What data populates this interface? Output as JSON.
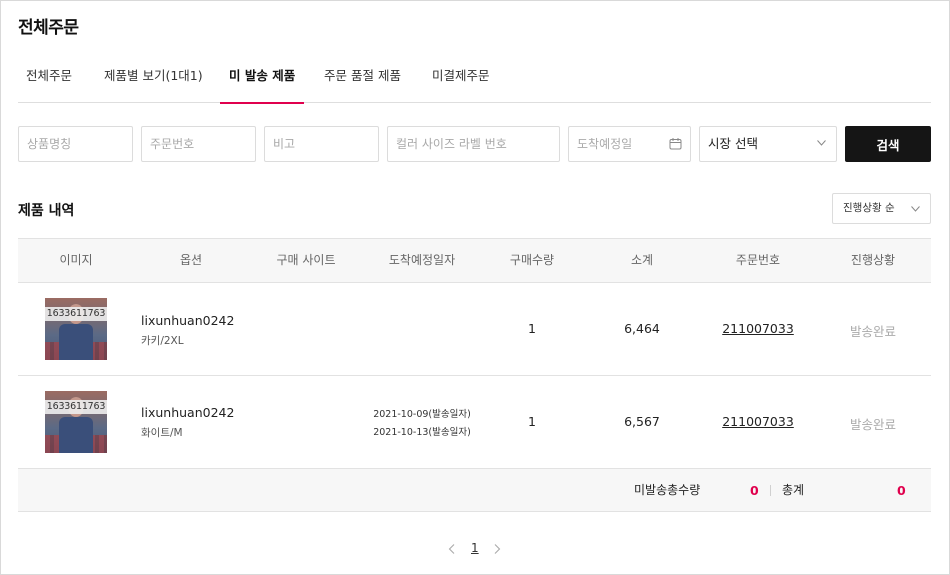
{
  "page": {
    "title": "전체주문"
  },
  "tabs": [
    {
      "label": "전체주문"
    },
    {
      "label": "제품별 보기(1대1)"
    },
    {
      "label": "미 발송 제품"
    },
    {
      "label": "주문 품절 제품"
    },
    {
      "label": "미결제주문"
    }
  ],
  "active_tab": "미 발송 제품",
  "filters": {
    "product_name_placeholder": "상품명칭",
    "order_no_placeholder": "주문번호",
    "note_placeholder": "비고",
    "label_no_placeholder": "컬러 사이즈 라벨 번호",
    "arrival_date_placeholder": "도착예정일",
    "market_select": "시장 선택",
    "search_button": "검색"
  },
  "section": {
    "title": "제품 내역",
    "sort_select": "진행상황 순"
  },
  "table": {
    "headers": [
      "이미지",
      "옵션",
      "구매 사이트",
      "도착예정일자",
      "구매수량",
      "소계",
      "주문번호",
      "진행상황"
    ],
    "rows": [
      {
        "image_id": "1633611763",
        "option_name": "lixunhuan0242",
        "option_detail": "카키/2XL",
        "site": "",
        "dates": [
          "",
          ""
        ],
        "qty": "1",
        "subtotal": "6,464",
        "order_no": "211007033",
        "status": "발송완료"
      },
      {
        "image_id": "1633611763",
        "option_name": "lixunhuan0242",
        "option_detail": "화이트/M",
        "site": "",
        "dates": [
          "2021-10-09(발송일자)",
          "2021-10-13(발송일자)"
        ],
        "qty": "1",
        "subtotal": "6,567",
        "order_no": "211007033",
        "status": "발송완료"
      }
    ]
  },
  "summary": {
    "unsent_label": "미발송총수량",
    "unsent_value": "0",
    "total_label": "총계",
    "total_value": "0"
  },
  "pagination": {
    "current": "1"
  },
  "colors": {
    "accent": "#e0004d",
    "button_dark": "#151515",
    "header_bg": "#f7f7f7"
  },
  "icons": [
    "calendar-icon",
    "chevron-down-icon",
    "chevron-left-icon",
    "chevron-right-icon"
  ]
}
